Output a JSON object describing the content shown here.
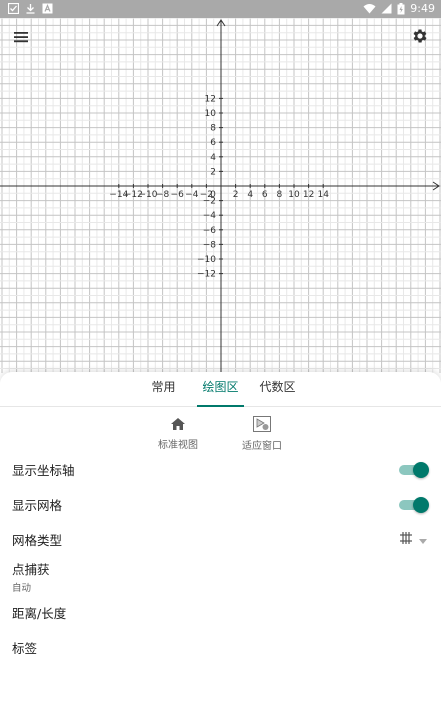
{
  "status_bar": {
    "time": "9:49"
  },
  "graph": {
    "x_axis_ticks": [
      "−14",
      "−12",
      "−10",
      "−8",
      "−6",
      "−4",
      "−2",
      "0",
      "2",
      "4",
      "6",
      "8",
      "10",
      "12",
      "14"
    ],
    "y_axis_ticks": [
      "12",
      "10",
      "8",
      "6",
      "4",
      "2",
      "−2",
      "−4",
      "−6",
      "−8",
      "−10",
      "−12"
    ]
  },
  "tabs": [
    {
      "label": "常用",
      "active": false
    },
    {
      "label": "绘图区",
      "active": true
    },
    {
      "label": "代数区",
      "active": false
    }
  ],
  "view_actions": {
    "standard_view": "标准视图",
    "fit_window": "适应窗口"
  },
  "settings": {
    "show_axes": {
      "label": "显示坐标轴",
      "on": true
    },
    "show_grid": {
      "label": "显示网格",
      "on": true
    },
    "grid_type": {
      "label": "网格类型"
    },
    "point_capture": {
      "label": "点捕获",
      "value": "自动"
    },
    "distance": {
      "label": "距离/长度"
    },
    "labeling": {
      "label": "标签"
    }
  },
  "colors": {
    "accent": "#00796b",
    "switch_track": "#8cc7bf",
    "status_bar": "#a9a9a9",
    "grid_minor": "#e8e8e8",
    "grid_major": "#c4c4c4"
  }
}
